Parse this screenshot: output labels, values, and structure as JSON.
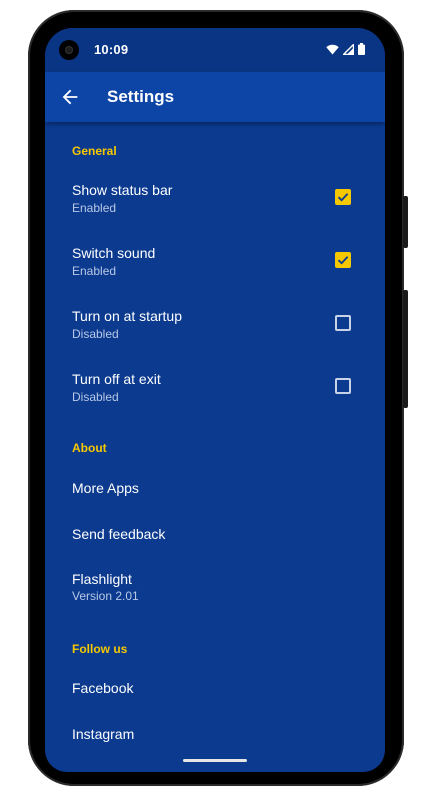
{
  "status_bar": {
    "time": "10:09",
    "icons": [
      "wifi-icon",
      "signal-icon",
      "battery-icon"
    ]
  },
  "app_bar": {
    "back_icon": "arrow-left-icon",
    "title": "Settings"
  },
  "sections": {
    "general": {
      "header": "General",
      "items": [
        {
          "title": "Show status bar",
          "summary": "Enabled",
          "checked": true
        },
        {
          "title": "Switch sound",
          "summary": "Enabled",
          "checked": true
        },
        {
          "title": "Turn on at startup",
          "summary": "Disabled",
          "checked": false
        },
        {
          "title": "Turn off at exit",
          "summary": "Disabled",
          "checked": false
        }
      ]
    },
    "about": {
      "header": "About",
      "items": [
        {
          "title": "More Apps"
        },
        {
          "title": "Send feedback"
        },
        {
          "title": "Flashlight",
          "summary": "Version 2.01"
        }
      ]
    },
    "follow": {
      "header": "Follow us",
      "items": [
        {
          "title": "Facebook"
        },
        {
          "title": "Instagram"
        }
      ]
    }
  },
  "colors": {
    "background": "#0b3a8f",
    "app_bar": "#0d45a6",
    "accent": "#f5c800",
    "summary_text": "#b9c8e6"
  }
}
